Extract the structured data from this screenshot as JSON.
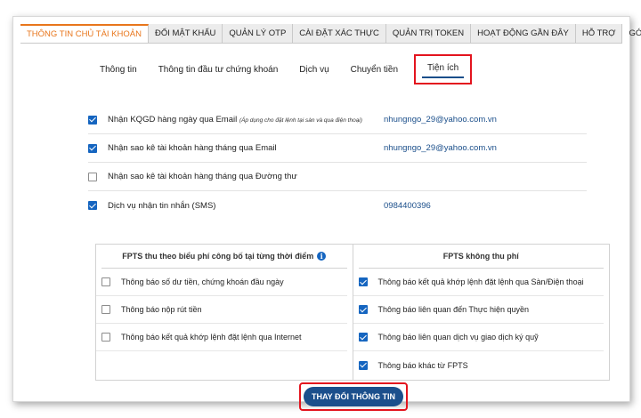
{
  "topnav": {
    "tabs": [
      {
        "label": "THÔNG TIN CHỦ TÀI KHOẢN",
        "active": true
      },
      {
        "label": "ĐỔI MẬT KHẨU",
        "active": false
      },
      {
        "label": "QUẢN LÝ OTP",
        "active": false
      },
      {
        "label": "CÀI ĐẶT XÁC THỰC",
        "active": false
      },
      {
        "label": "QUẢN TRỊ TOKEN",
        "active": false
      },
      {
        "label": "HOẠT ĐỘNG GẦN ĐÂY",
        "active": false
      },
      {
        "label": "HỖ TRỢ",
        "active": false
      },
      {
        "label": "GÓP Ý",
        "active": false
      }
    ]
  },
  "subtabs": {
    "items": [
      "Thông tin",
      "Thông tin đầu tư chứng khoán",
      "Dịch vụ",
      "Chuyển tiền"
    ],
    "active": "Tiện ích"
  },
  "options": [
    {
      "label": "Nhận KQGD hàng ngày qua Email",
      "note": "(Áp dụng cho đặt lệnh tại sàn và qua điện thoại)",
      "value": "nhungngo_29@yahoo.com.vn",
      "checked": true
    },
    {
      "label": "Nhận sao kê tài khoản hàng tháng qua Email",
      "note": "",
      "value": "nhungngo_29@yahoo.com.vn",
      "checked": true
    },
    {
      "label": "Nhận sao kê tài khoản hàng tháng qua Đường thư",
      "note": "",
      "value": "",
      "checked": false
    },
    {
      "label": "Dịch vụ nhận tin nhắn (SMS)",
      "note": "",
      "value": "0984400396",
      "checked": true
    }
  ],
  "panel": {
    "left": {
      "heading": "FPTS thu theo biểu phí công bố tại từng thời điểm",
      "items": [
        {
          "label": "Thông báo số dư tiền, chứng khoán đầu ngày",
          "checked": false
        },
        {
          "label": "Thông báo nộp rút tiền",
          "checked": false
        },
        {
          "label": "Thông báo kết quả khớp lệnh đặt lệnh qua Internet",
          "checked": false
        }
      ]
    },
    "right": {
      "heading": "FPTS không thu phí",
      "items": [
        {
          "label": "Thông báo kết quả khớp lệnh đặt lệnh qua Sàn/Điện thoại",
          "checked": true
        },
        {
          "label": "Thông báo liên quan đến Thực hiện quyền",
          "checked": true
        },
        {
          "label": "Thông báo liên quan dịch vụ giao dịch ký quỹ",
          "checked": true
        },
        {
          "label": "Thông báo khác từ FPTS",
          "checked": true
        }
      ]
    }
  },
  "submit": {
    "label": "THAY ĐỔI THÔNG TIN"
  },
  "colors": {
    "accent": "#e8761c",
    "primary": "#1b4f8c",
    "highlight": "#e3141e",
    "checkbox": "#1565c0"
  }
}
